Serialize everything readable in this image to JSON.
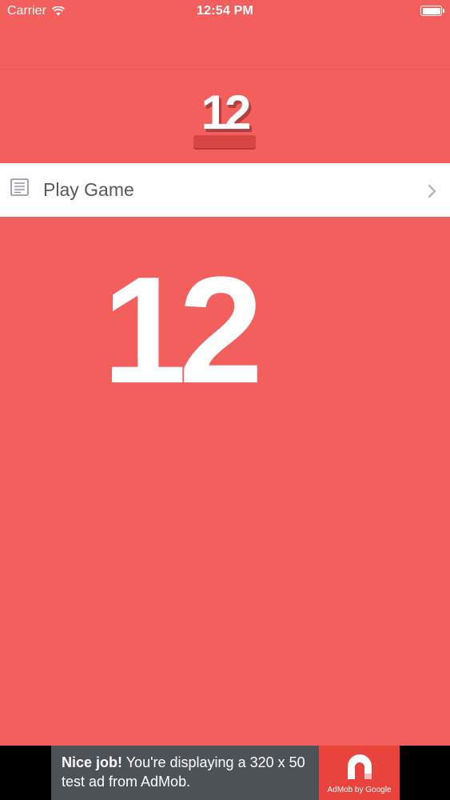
{
  "status_bar": {
    "carrier": "Carrier",
    "time": "12:54 PM",
    "icons": [
      "wifi-icon",
      "battery-icon"
    ]
  },
  "header": {
    "logo_text": "12"
  },
  "menu": {
    "items": [
      {
        "label": "Play Game",
        "icon": "document-icon",
        "accessory": "chevron-right-icon"
      }
    ]
  },
  "main": {
    "number": "12"
  },
  "ad": {
    "headline": "Nice job!",
    "message": "You're displaying a 320 x 50 test ad from AdMob.",
    "brand": "AdMob by Google"
  },
  "colors": {
    "background": "#f25f5c",
    "menu_row": "#ffffff",
    "menu_text": "#555a5e",
    "ad_background": "#4d5257",
    "ad_logo_background": "#e8433c"
  }
}
